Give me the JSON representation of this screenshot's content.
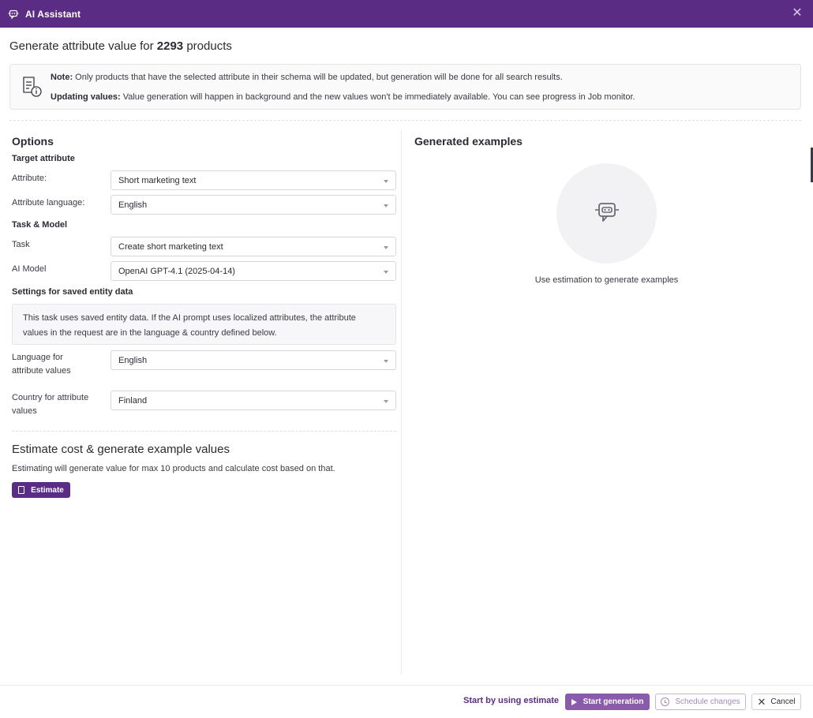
{
  "window": {
    "title": "AI Assistant",
    "icon": "ai-chat-icon",
    "close_icon": "close-icon",
    "accent_color": "#5b2c83"
  },
  "heading": {
    "prefix": "Generate attribute value for",
    "count": "2293",
    "suffix": "products"
  },
  "note": {
    "icon": "document-info-icon",
    "line1_label": "Note:",
    "line1_text": "Only products that have the selected attribute in their schema will be updated, but generation will be done for all search results.",
    "line2_label": "Updating values:",
    "line2_text": "Value generation will happen in background and the new values won't be immediately available. You can see progress in Job monitor."
  },
  "options": {
    "title": "Options",
    "target_attribute": {
      "title": "Target attribute",
      "attribute_label": "Attribute:",
      "attribute_value": "Short marketing text",
      "language_label": "Attribute language:",
      "language_value": "English"
    },
    "task_model": {
      "title": "Task & Model",
      "task_label": "Task",
      "task_value": "Create short marketing text",
      "model_label": "AI Model",
      "model_value": "OpenAI GPT-4.1 (2025-04-14)"
    },
    "saved_entity": {
      "title": "Settings for saved entity data",
      "info_line1": "This task uses saved entity data. If the AI prompt uses localized attributes, the attribute",
      "info_line2": "values in the request are in the language & country defined below.",
      "language_label_1": "Language for",
      "language_label_2": "attribute values",
      "language_value": "English",
      "country_label_1": "Country for attribute",
      "country_label_2": "values",
      "country_value": "Finland"
    }
  },
  "estimate": {
    "title": "Estimate cost & generate example values",
    "description": "Estimating will generate value for max 10 products and calculate cost based on that.",
    "button_label": "Estimate",
    "button_icon": "calculator-icon"
  },
  "examples": {
    "title": "Generated examples",
    "icon": "robot-chat-icon",
    "hint": "Use estimation to generate examples"
  },
  "footer": {
    "hint": "Start by using estimate",
    "start_label": "Start generation",
    "start_icon": "play-icon",
    "schedule_label": "Schedule changes",
    "schedule_icon": "clock-icon",
    "cancel_label": "Cancel",
    "cancel_icon": "close-icon"
  }
}
